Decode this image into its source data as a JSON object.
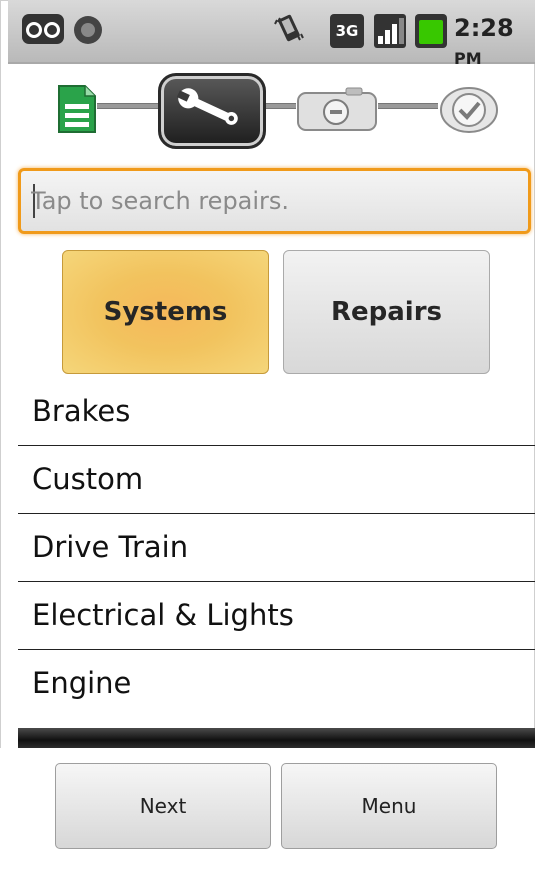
{
  "status_bar": {
    "network_label": "3G",
    "time": "2:28",
    "ampm": "PM",
    "icons": [
      "voicemail-icon",
      "usb-icon",
      "vibrate-icon",
      "network-3g-icon",
      "signal-icon",
      "battery-icon"
    ]
  },
  "wizard": {
    "steps": [
      "document-step-icon",
      "tools-step-icon",
      "camera-step-icon",
      "check-step-icon"
    ],
    "active_step": "tools-step-icon"
  },
  "search": {
    "placeholder": "Tap to search repairs.",
    "value": ""
  },
  "segments": {
    "systems": "Systems",
    "repairs": "Repairs",
    "selected": "Systems"
  },
  "list": {
    "items": [
      {
        "label": "Brakes"
      },
      {
        "label": "Custom"
      },
      {
        "label": "Drive Train"
      },
      {
        "label": "Electrical & Lights"
      },
      {
        "label": "Engine"
      }
    ]
  },
  "bottom_bar": {
    "next_label": "Next",
    "menu_label": "Menu"
  },
  "colors": {
    "accent_orange": "#f09a1a",
    "selected_segment": "#f2c35e",
    "battery_green": "#38c800"
  }
}
